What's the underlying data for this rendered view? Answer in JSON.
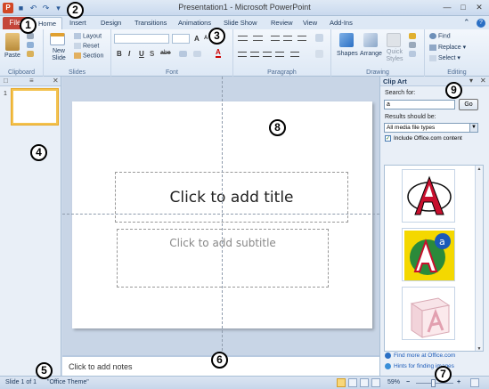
{
  "window": {
    "title": "Presentation1 - Microsoft PowerPoint",
    "app_logo": "P",
    "qat_icons": [
      "save-icon",
      "undo-icon",
      "redo-icon",
      "customize-qat-icon"
    ],
    "controls": [
      "minimize-icon",
      "maximize-icon",
      "close-icon"
    ]
  },
  "tabs": {
    "file": "File",
    "items": [
      "Home",
      "Insert",
      "Design",
      "Transitions",
      "Animations",
      "Slide Show",
      "Review",
      "View",
      "Add-Ins"
    ],
    "active": "Home"
  },
  "ribbon": {
    "clipboard": {
      "label": "Clipboard",
      "paste": "Paste"
    },
    "slides": {
      "label": "Slides",
      "new_slide": "New Slide",
      "layout": "Layout",
      "reset": "Reset",
      "section": "Section"
    },
    "font": {
      "label": "Font",
      "bold": "B",
      "italic": "I",
      "underline": "U",
      "shadow": "S",
      "strike": "abe"
    },
    "paragraph": {
      "label": "Paragraph"
    },
    "drawing": {
      "label": "Drawing",
      "shapes": "Shapes",
      "arrange": "Arrange",
      "quick_styles": "Quick Styles"
    },
    "editing": {
      "label": "Editing",
      "find": "Find",
      "replace": "Replace",
      "select": "Select"
    }
  },
  "slides_pane": {
    "slide_number": "1"
  },
  "slide": {
    "title_placeholder": "Click to add title",
    "subtitle_placeholder": "Click to add subtitle"
  },
  "notes": {
    "placeholder": "Click to add notes"
  },
  "clip_art": {
    "title": "Clip Art",
    "search_label": "Search for:",
    "search_value": "a",
    "go_button": "Go",
    "results_label": "Results should be:",
    "results_value": "All media file types",
    "include_office": "Include Office.com content",
    "include_checked": true,
    "find_more": "Find more at Office.com",
    "hints": "Hints for finding images"
  },
  "status_bar": {
    "slide_info": "Slide 1 of 1",
    "theme": "\"Office Theme\"",
    "zoom": "59%"
  },
  "callouts": [
    "1",
    "2",
    "3",
    "4",
    "5",
    "6",
    "7",
    "8",
    "9"
  ],
  "colors": {
    "file_tab": "#c4453a",
    "selection": "#f3c24f",
    "link": "#1a5ab8"
  }
}
